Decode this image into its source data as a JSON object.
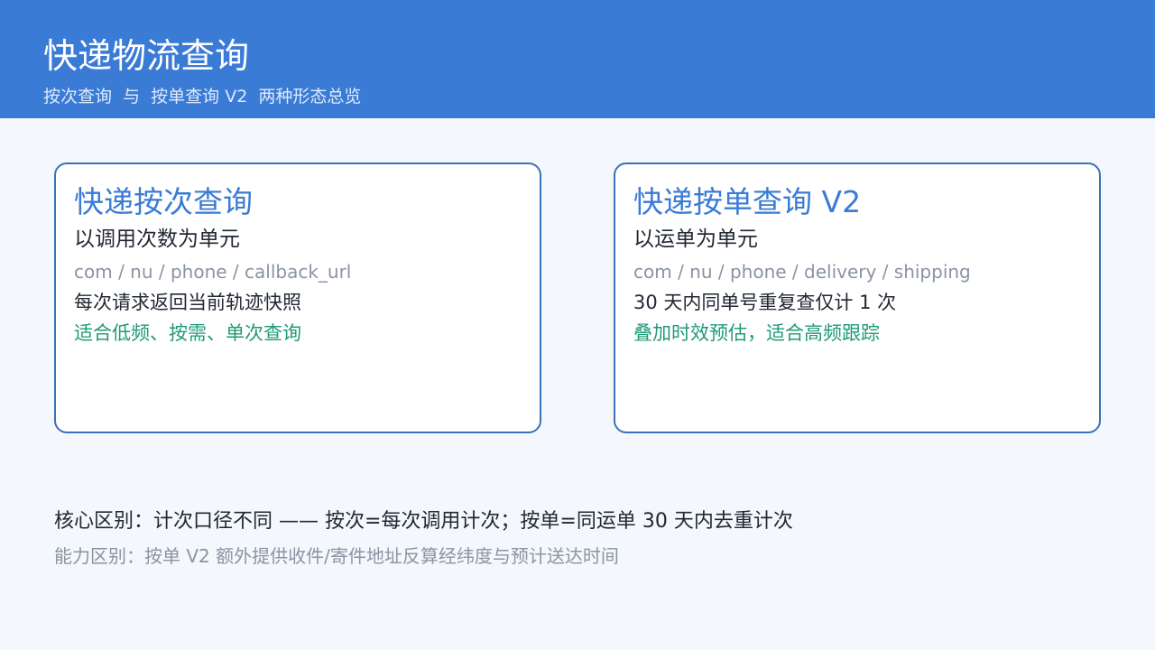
{
  "header": {
    "title": "快递物流查询",
    "subtitle": "按次查询  与  按单查询 V2  两种形态总览"
  },
  "cards": [
    {
      "title": "快递按次查询",
      "unit": "以调用次数为单元",
      "params": "com / nu / phone / callback_url",
      "desc": "每次请求返回当前轨迹快照",
      "highlight": "适合低频、按需、单次查询"
    },
    {
      "title": "快递按单查询 V2",
      "unit": "以运单为单元",
      "params": "com / nu / phone / delivery / shipping",
      "desc": "30 天内同单号重复查仅计 1 次",
      "highlight": "叠加时效预估，适合高频跟踪"
    }
  ],
  "notes": {
    "primary": "核心区别：计次口径不同 —— 按次=每次调用计次；按单=同运单 30 天内去重计次",
    "secondary": "能力区别：按单 V2 额外提供收件/寄件地址反算经纬度与预计送达时间"
  },
  "colors": {
    "header_bg": "#3a7bd5",
    "accent_blue": "#3a7bd5",
    "card_border": "#3a72b8",
    "highlight_green": "#1f9a78",
    "muted_gray": "#8a94a3",
    "page_bg": "#f4f8fc"
  }
}
